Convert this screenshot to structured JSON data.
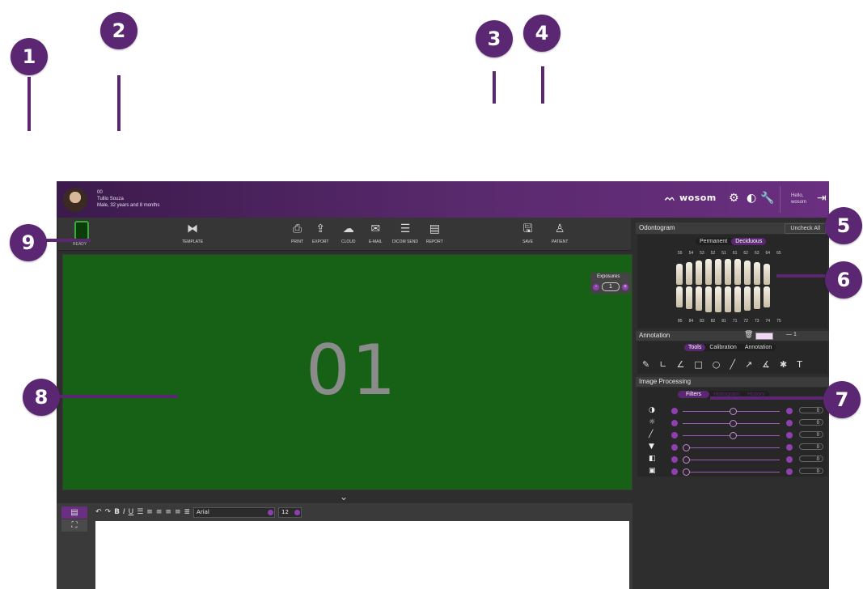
{
  "callouts": [
    "1",
    "2",
    "3",
    "4",
    "5",
    "6",
    "7",
    "8",
    "9"
  ],
  "patient": {
    "id": "00",
    "name": "Tullio Souza",
    "details": "Male, 32 years and 8 months"
  },
  "brand": {
    "logo": "wosom"
  },
  "user": {
    "greeting": "Hello,",
    "name": "wosom"
  },
  "toolbar": {
    "ready_label": "READY",
    "template_label": "TEMPLATE",
    "print_label": "PRINT",
    "export_label": "EXPORT",
    "cloud_label": "CLOUD",
    "email_label": "E-MAIL",
    "dicom_label": "DICOM SEND",
    "report_label": "REPORT",
    "save_label": "SAVE",
    "patient_label": "PATIENT"
  },
  "viewer": {
    "image_number": "01",
    "exposures_label": "Exposures",
    "exposures_value": "1",
    "exposures_minus": "-",
    "exposures_plus": "+"
  },
  "notes": {
    "font": "Arial",
    "size": "12"
  },
  "odontogram": {
    "title": "Odontogram",
    "uncheck_all": "Uncheck All",
    "tabs": [
      "Permanent",
      "Deciduous"
    ],
    "upper_numbers": [
      "55",
      "54",
      "53",
      "52",
      "51",
      "61",
      "62",
      "63",
      "64",
      "65"
    ],
    "lower_numbers": [
      "85",
      "84",
      "83",
      "82",
      "81",
      "71",
      "72",
      "73",
      "74",
      "75"
    ]
  },
  "annotation": {
    "title": "Annotation",
    "tabs": [
      "Tools",
      "Calibration",
      "Annotation"
    ],
    "line_value": "1"
  },
  "image_processing": {
    "title": "Image Processing",
    "tabs": [
      "Filters",
      "Histogram",
      "History"
    ],
    "sliders": [
      {
        "icon": "contrast-icon",
        "value": "0",
        "level": 0.5
      },
      {
        "icon": "brightness-icon",
        "value": "0",
        "level": 0.5
      },
      {
        "icon": "gamma-icon",
        "value": "0",
        "level": 0.5
      },
      {
        "icon": "sharpen-icon",
        "value": "0",
        "level": 0.0
      },
      {
        "icon": "invert-icon",
        "value": "0",
        "level": 0.0
      },
      {
        "icon": "frame-icon",
        "value": "0",
        "level": 0.0
      }
    ]
  },
  "colors": {
    "accent": "#5b2773",
    "viewer_bg": "#176116",
    "panel_bg": "#2e2e2e",
    "header": "#5a2a6e"
  }
}
